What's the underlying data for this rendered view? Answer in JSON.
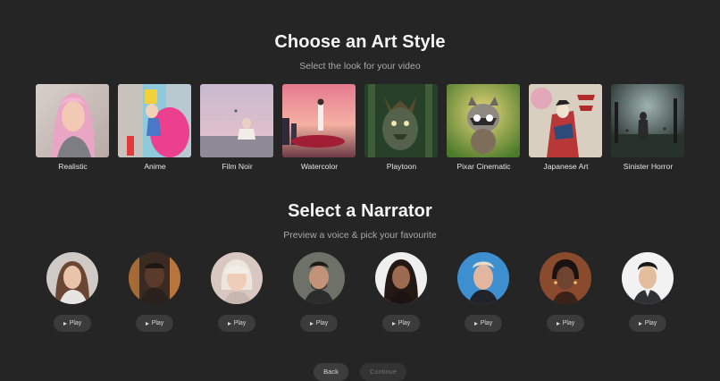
{
  "art_section": {
    "title": "Choose an Art Style",
    "subtitle": "Select the look for your video",
    "styles": [
      {
        "label": "Realistic"
      },
      {
        "label": "Anime"
      },
      {
        "label": "Film Noir"
      },
      {
        "label": "Watercolor"
      },
      {
        "label": "Playtoon"
      },
      {
        "label": "Pixar Cinematic"
      },
      {
        "label": "Japanese Art"
      },
      {
        "label": "Sinister Horror"
      }
    ]
  },
  "narrator_section": {
    "title": "Select a Narrator",
    "subtitle": "Preview a voice & pick your favourite",
    "play_label": "Play",
    "narrators": [
      {
        "avatar": "woman-long-brown-hair"
      },
      {
        "avatar": "man-short-hair-dark-skin"
      },
      {
        "avatar": "woman-blonde-bob"
      },
      {
        "avatar": "man-dark-beard"
      },
      {
        "avatar": "woman-long-dark-hair"
      },
      {
        "avatar": "man-blonde-blue-background"
      },
      {
        "avatar": "woman-dark-skin-earrings"
      },
      {
        "avatar": "man-asian-white-background"
      }
    ]
  },
  "footer": {
    "back_label": "Back",
    "continue_label": "Continue"
  }
}
